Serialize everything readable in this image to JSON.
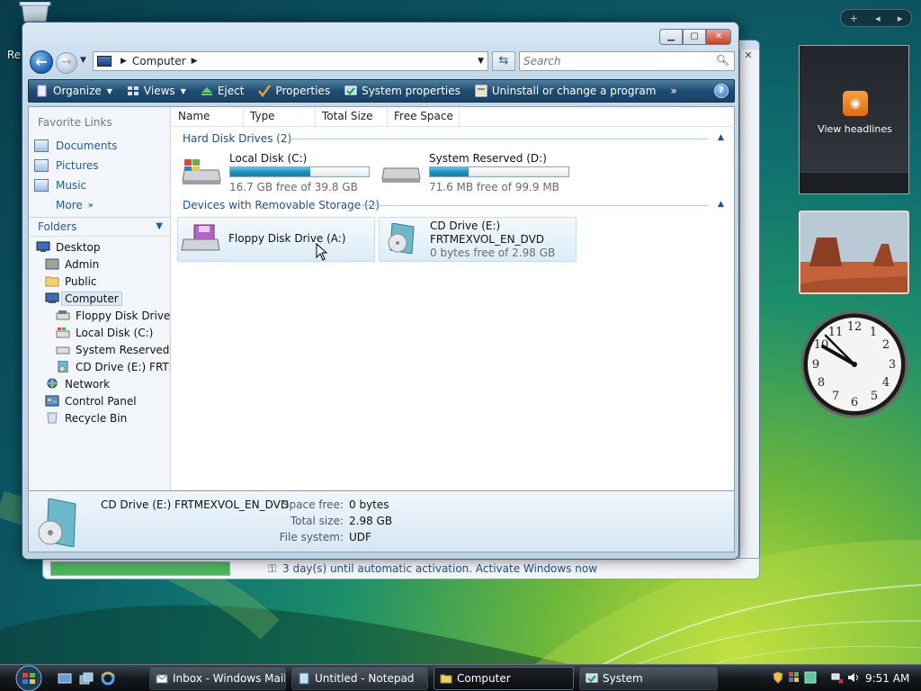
{
  "desktop": {
    "recycle_label": "Re"
  },
  "background_window": {
    "activation_text": "3 day(s) until automatic activation. Activate Windows now",
    "progress_percent": 100
  },
  "window": {
    "address": {
      "location": "Computer"
    },
    "search": {
      "placeholder": "Search"
    },
    "toolbar": {
      "organize": "Organize",
      "views": "Views",
      "eject": "Eject",
      "properties": "Properties",
      "system_properties": "System properties",
      "uninstall": "Uninstall or change a program",
      "more": "»"
    },
    "nav_pane": {
      "favorites_header": "Favorite Links",
      "favorites": [
        "Documents",
        "Pictures",
        "Music"
      ],
      "more": "More",
      "folders_header": "Folders",
      "tree": [
        {
          "label": "Desktop",
          "level": 0
        },
        {
          "label": "Admin",
          "level": 1
        },
        {
          "label": "Public",
          "level": 1
        },
        {
          "label": "Computer",
          "level": 1,
          "selected": true
        },
        {
          "label": "Floppy Disk Drive (A:)",
          "level": 2
        },
        {
          "label": "Local Disk (C:)",
          "level": 2
        },
        {
          "label": "System Reserved (D:)",
          "level": 2
        },
        {
          "label": "CD Drive (E:) FRTMEXVOL_EN_DVD",
          "level": 2
        },
        {
          "label": "Network",
          "level": 1
        },
        {
          "label": "Control Panel",
          "level": 1
        },
        {
          "label": "Recycle Bin",
          "level": 1
        }
      ]
    },
    "columns": [
      "Name",
      "Type",
      "Total Size",
      "Free Space"
    ],
    "groups": {
      "hard_disks": "Hard Disk Drives (2)",
      "removable": "Devices with Removable Storage (2)"
    },
    "drives": {
      "c": {
        "name": "Local Disk (C:)",
        "free_text": "16.7 GB free of 39.8 GB",
        "used_fraction": 0.58
      },
      "d": {
        "name": "System Reserved (D:)",
        "free_text": "71.6 MB free of 99.9 MB",
        "used_fraction": 0.28
      },
      "a": {
        "name": "Floppy Disk Drive (A:)"
      },
      "e": {
        "name": "CD Drive (E:)",
        "label": "FRTMEXVOL_EN_DVD",
        "free_text": "0 bytes free of 2.98 GB"
      }
    },
    "details": {
      "title": "CD Drive (E:) FRTMEXVOL_EN_DVD",
      "space_free_label": "Space free:",
      "space_free": "0 bytes",
      "total_size_label": "Total size:",
      "total_size": "2.98 GB",
      "file_system_label": "File system:",
      "file_system": "UDF"
    }
  },
  "sidebar": {
    "rss_label": "View headlines",
    "clock_time": "9:51"
  },
  "taskbar": {
    "tasks": [
      "Inbox - Windows Mail",
      "Untitled - Notepad",
      "Computer",
      "System"
    ],
    "time": "9:51 AM"
  },
  "colors": {
    "accent": "#1c4fa0",
    "toolbar": "#1e4d72",
    "progress": "#1f8fc0"
  }
}
